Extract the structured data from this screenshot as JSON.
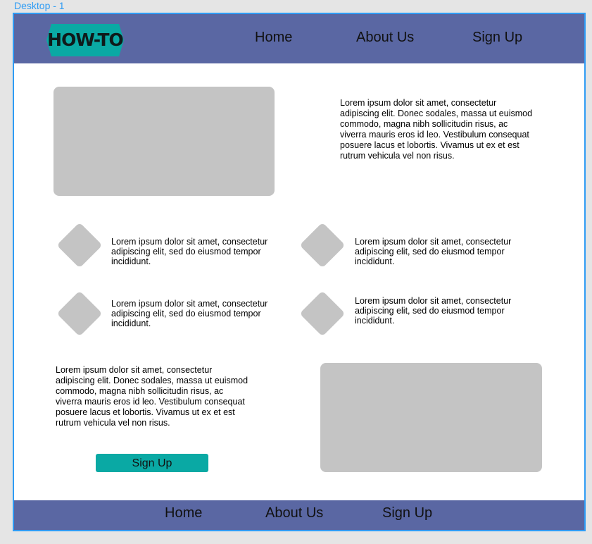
{
  "frame": {
    "label": "Desktop - 1"
  },
  "header": {
    "logo_text": "HOW-TO",
    "nav": [
      "Home",
      "About Us",
      "Sign Up"
    ]
  },
  "intro": {
    "text": "Lorem ipsum dolor sit amet, consectetur adipiscing elit. Donec sodales, massa ut euismod commodo, magna nibh sollicitudin risus, ac viverra mauris eros id leo. Vestibulum consequat posuere lacus et lobortis. Vivamus ut ex et est rutrum vehicula vel non risus."
  },
  "features": [
    {
      "text": "Lorem ipsum dolor sit amet, consectetur adipiscing elit, sed do eiusmod tempor incididunt."
    },
    {
      "text": "Lorem ipsum dolor sit amet, consectetur adipiscing elit, sed do eiusmod tempor incididunt."
    },
    {
      "text": "Lorem ipsum dolor sit amet, consectetur adipiscing elit, sed do eiusmod tempor incididunt."
    },
    {
      "text": "Lorem ipsum dolor sit amet, consectetur adipiscing elit, sed do eiusmod tempor incididunt."
    }
  ],
  "bottom": {
    "text": "Lorem ipsum dolor sit amet, consectetur adipiscing elit. Donec sodales, massa ut euismod commodo, magna nibh sollicitudin risus, ac viverra mauris eros id leo. Vestibulum consequat posuere lacus et lobortis. Vivamus ut ex et est rutrum vehicula vel non risus.",
    "cta_label": "Sign Up"
  },
  "footer": {
    "nav": [
      "Home",
      "About Us",
      "Sign Up"
    ]
  },
  "colors": {
    "nav_bar": "#5a67a3",
    "accent_teal": "#0aa9a4",
    "placeholder": "#c4c4c4",
    "frame_border": "#2f9cf4"
  }
}
